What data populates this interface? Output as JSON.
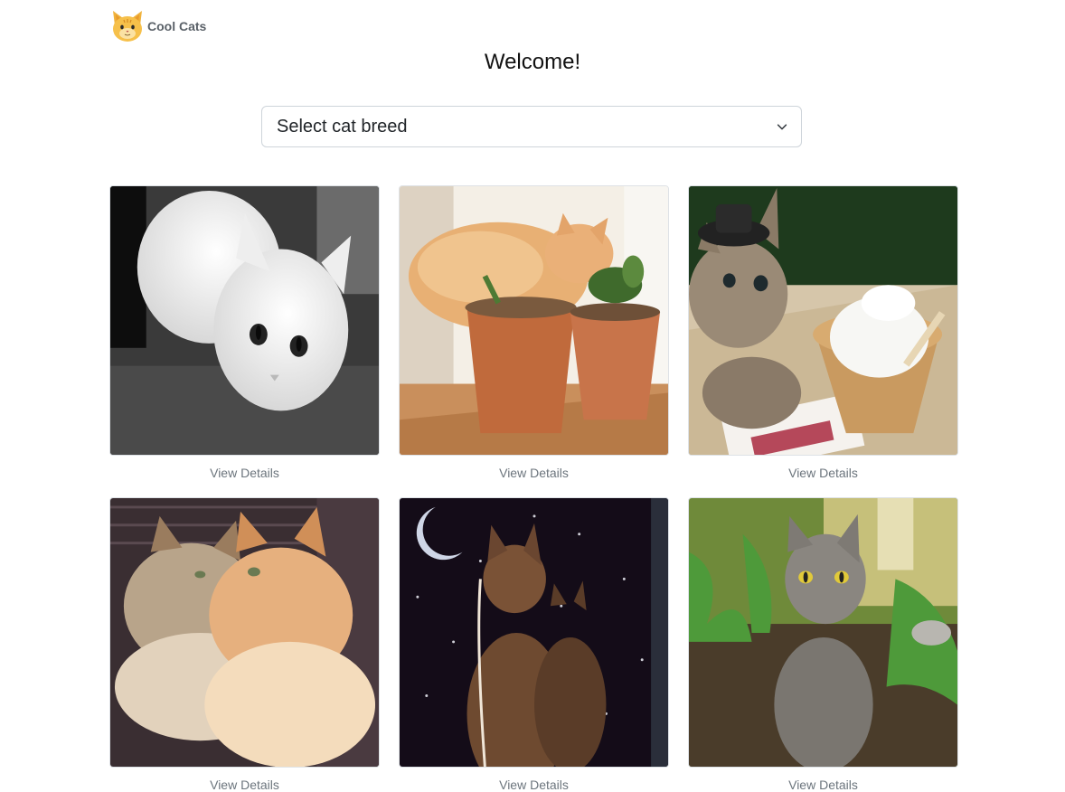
{
  "header": {
    "brand_name": "Cool Cats",
    "logo_icon": "cat-face-icon"
  },
  "main": {
    "welcome": "Welcome!",
    "breed_select": {
      "selected_label": "Select cat breed"
    },
    "cards": [
      {
        "image": "white-cat-photo",
        "link_label": "View Details"
      },
      {
        "image": "orange-cat-plant-pots-photo",
        "link_label": "View Details"
      },
      {
        "image": "kitten-hat-ice-cream-photo",
        "link_label": "View Details"
      },
      {
        "image": "two-fluffy-kittens-photo",
        "link_label": "View Details"
      },
      {
        "image": "cats-night-moon-photo",
        "link_label": "View Details"
      },
      {
        "image": "gray-cat-garden-photo",
        "link_label": "View Details"
      }
    ]
  },
  "colors": {
    "link_gray": "#6c757d",
    "border": "#ced4da",
    "brand_text": "#5a6168"
  }
}
